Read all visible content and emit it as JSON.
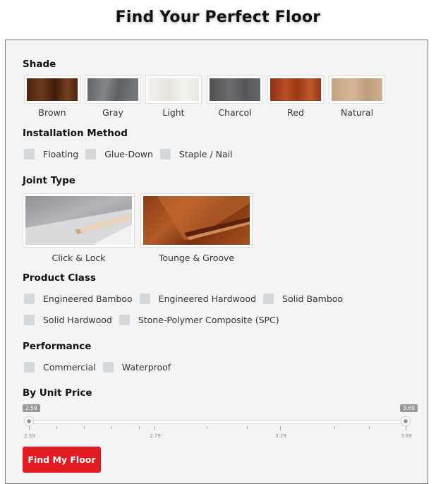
{
  "title": "Find Your Perfect Floor",
  "shade": {
    "label": "Shade",
    "items": [
      {
        "label": "Brown",
        "color": "#5a2d14"
      },
      {
        "label": "Gray",
        "color": "#6f7276"
      },
      {
        "label": "Light",
        "color": "#efede6"
      },
      {
        "label": "Charcol",
        "color": "#5c5e60"
      },
      {
        "label": "Red",
        "color": "#a2401c"
      },
      {
        "label": "Natural",
        "color": "#c8a888"
      }
    ]
  },
  "installation": {
    "label": "Installation Method",
    "options": [
      "Floating",
      "Glue-Down",
      "Staple / Nail"
    ]
  },
  "joint": {
    "label": "Joint Type",
    "items": [
      {
        "label": "Click & Lock"
      },
      {
        "label": "Tounge & Groove"
      }
    ]
  },
  "product_class": {
    "label": "Product Class",
    "row1": [
      "Engineered Bamboo",
      "Engineered Hardwood",
      "Solid Bamboo"
    ],
    "row2": [
      "Solid Hardwood",
      "Stone-Polymer Composite (SPC)"
    ]
  },
  "performance": {
    "label": "Performance",
    "options": [
      "Commercial",
      "Waterproof"
    ]
  },
  "price": {
    "label": "By Unit Price",
    "min_value": "2.59",
    "max_value": "3.69",
    "tick_labels": [
      "2.59",
      "2.79",
      "3.29",
      "3.69"
    ]
  },
  "button": {
    "label": "Find My Floor"
  },
  "colors": {
    "accent": "#e31c23",
    "checkbox": "#d4d8dc"
  }
}
